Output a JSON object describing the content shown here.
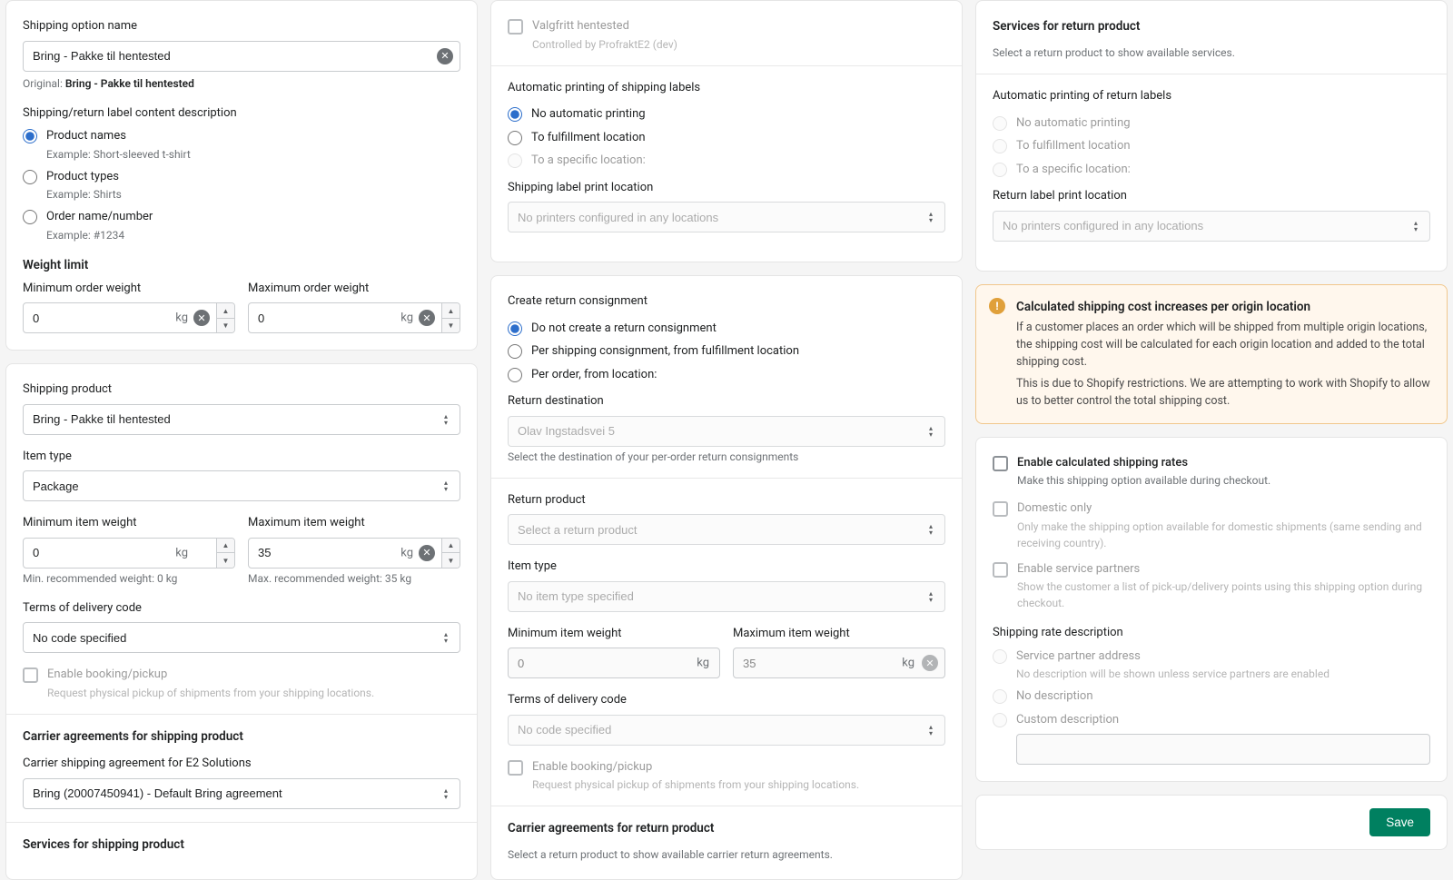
{
  "col1": {
    "shipping_option_name_label": "Shipping option name",
    "shipping_option_name": "Bring - Pakke til hentested",
    "original_prefix": "Original: ",
    "original_value": "Bring - Pakke til hentested",
    "label_desc_heading": "Shipping/return label content description",
    "label_desc_options": [
      {
        "label": "Product names",
        "example": "Example: Short-sleeved t-shirt",
        "checked": true
      },
      {
        "label": "Product types",
        "example": "Example: Shirts",
        "checked": false
      },
      {
        "label": "Order name/number",
        "example": "Example: #1234",
        "checked": false
      }
    ],
    "weight_limit_heading": "Weight limit",
    "min_order_weight_label": "Minimum order weight",
    "min_order_weight": "0",
    "max_order_weight_label": "Maximum order weight",
    "max_order_weight": "0",
    "kg": "kg",
    "shipping_product_label": "Shipping product",
    "shipping_product": "Bring - Pakke til hentested",
    "item_type_label": "Item type",
    "item_type": "Package",
    "min_item_weight_label": "Minimum item weight",
    "min_item_weight": "0",
    "min_rec": "Min. recommended weight: 0 kg",
    "max_item_weight_label": "Maximum item weight",
    "max_item_weight": "35",
    "max_rec": "Max. recommended weight: 35 kg",
    "terms_label": "Terms of delivery code",
    "terms_value": "No code specified",
    "enable_booking_label": "Enable booking/pickup",
    "enable_booking_hint": "Request physical pickup of shipments from your shipping locations.",
    "carrier_agreements_heading": "Carrier agreements for shipping product",
    "carrier_agreement_label": "Carrier shipping agreement for E2 Solutions",
    "carrier_agreement_value": "Bring (20007450941) - Default Bring agreement",
    "services_heading": "Services for shipping product"
  },
  "col2": {
    "valgfritt_label": "Valgfritt hentested",
    "valgfritt_hint": "Controlled by ProfraktE2 (dev)",
    "auto_print_heading": "Automatic printing of shipping labels",
    "auto_print_options": [
      {
        "label": "No automatic printing",
        "checked": true,
        "disabled": false
      },
      {
        "label": "To fulfillment location",
        "checked": false,
        "disabled": false
      },
      {
        "label": "To a specific location:",
        "checked": false,
        "disabled": true
      }
    ],
    "print_location_label": "Shipping label print location",
    "print_location_value": "No printers configured in any locations",
    "create_return_heading": "Create return consignment",
    "create_return_options": [
      {
        "label": "Do not create a return consignment",
        "checked": true
      },
      {
        "label": "Per shipping consignment, from fulfillment location",
        "checked": false
      },
      {
        "label": "Per order, from location:",
        "checked": false
      }
    ],
    "return_dest_label": "Return destination",
    "return_dest_value": "Olav Ingstadsvei 5",
    "return_dest_hint": "Select the destination of your per-order return consignments",
    "return_product_label": "Return product",
    "return_product_placeholder": "Select a return product",
    "item_type_label": "Item type",
    "item_type_value": "No item type specified",
    "min_item_weight_label": "Minimum item weight",
    "min_item_weight": "0",
    "max_item_weight_label": "Maximum item weight",
    "max_item_weight": "35",
    "kg": "kg",
    "terms_label": "Terms of delivery code",
    "terms_value": "No code specified",
    "enable_booking_label": "Enable booking/pickup",
    "enable_booking_hint": "Request physical pickup of shipments from your shipping locations.",
    "carrier_return_heading": "Carrier agreements for return product",
    "carrier_return_hint": "Select a return product to show available carrier return agreements."
  },
  "col3": {
    "services_return_heading": "Services for return product",
    "services_return_hint": "Select a return product to show available services.",
    "auto_return_print_heading": "Automatic printing of return labels",
    "auto_return_print_options": [
      {
        "label": "No automatic printing"
      },
      {
        "label": "To fulfillment location"
      },
      {
        "label": "To a specific location:"
      }
    ],
    "return_print_location_label": "Return label print location",
    "return_print_location_value": "No printers configured in any locations",
    "banner_title": "Calculated shipping cost increases per origin location",
    "banner_p1": "If a customer places an order which will be shipped from multiple origin locations, the shipping cost will be calculated for each origin location and added to the total shipping cost.",
    "banner_p2": "This is due to Shopify restrictions. We are attempting to work with Shopify to allow us to better control the total shipping cost.",
    "enable_calc_label": "Enable calculated shipping rates",
    "enable_calc_hint": "Make this shipping option available during checkout.",
    "domestic_label": "Domestic only",
    "domestic_hint": "Only make the shipping option available for domestic shipments (same sending and receiving country).",
    "service_partners_label": "Enable service partners",
    "service_partners_hint": "Show the customer a list of pick-up/delivery points using this shipping option during checkout.",
    "rate_desc_heading": "Shipping rate description",
    "rate_desc_options": [
      {
        "label": "Service partner address",
        "hint": "No description will be shown unless service partners are enabled",
        "disabled": true
      },
      {
        "label": "No description",
        "disabled": true
      },
      {
        "label": "Custom description",
        "disabled": true
      }
    ],
    "save": "Save"
  }
}
